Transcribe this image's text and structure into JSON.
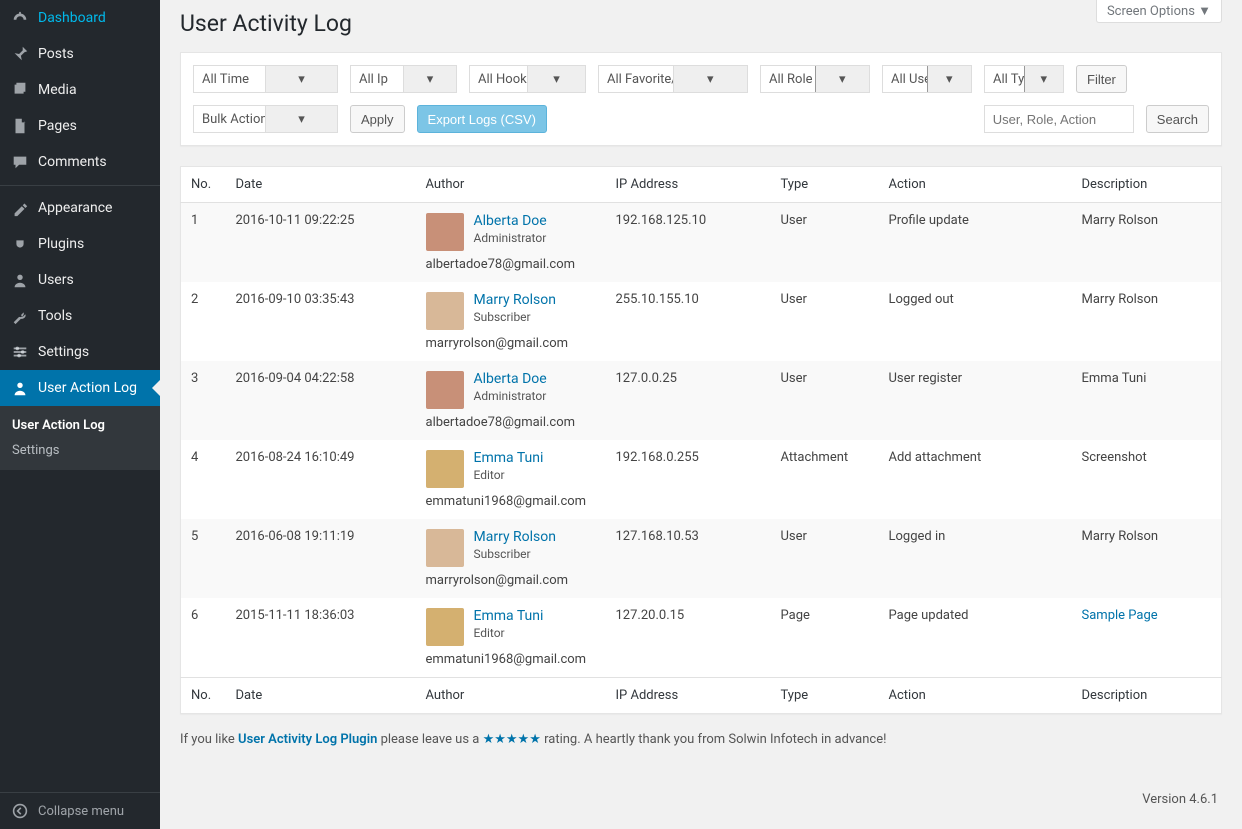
{
  "screen_options": "Screen Options ▼",
  "page_title": "User Activity Log",
  "sidebar": {
    "items": [
      {
        "icon": "dashboard",
        "label": "Dashboard"
      },
      {
        "icon": "pin",
        "label": "Posts"
      },
      {
        "icon": "media",
        "label": "Media"
      },
      {
        "icon": "page",
        "label": "Pages"
      },
      {
        "icon": "comment",
        "label": "Comments"
      },
      {
        "sep": true
      },
      {
        "icon": "appearance",
        "label": "Appearance"
      },
      {
        "icon": "plug",
        "label": "Plugins"
      },
      {
        "icon": "user",
        "label": "Users"
      },
      {
        "icon": "wrench",
        "label": "Tools"
      },
      {
        "icon": "settings",
        "label": "Settings"
      },
      {
        "icon": "user",
        "label": "User Action Log",
        "active": true
      }
    ],
    "submenu": [
      {
        "label": "User Action Log",
        "current": true
      },
      {
        "label": "Settings"
      }
    ],
    "collapse": "Collapse menu"
  },
  "filters": {
    "time": "All Time",
    "ip": "All Ip",
    "hook": "All Hook",
    "fav": "All Favorite/Unfavorite",
    "role": "All Role",
    "user": "All User",
    "type": "All Type",
    "filter_btn": "Filter",
    "bulk": "Bulk Actions",
    "apply": "Apply",
    "export": "Export Logs (CSV)",
    "search_ph": "User, Role, Action",
    "search_btn": "Search",
    "w_time": 145,
    "w_ip": 107,
    "w_hook": 117,
    "w_fav": 150,
    "w_role": 110,
    "w_user": 90,
    "w_type": 80,
    "w_bulk": 145
  },
  "columns": {
    "no": "No.",
    "date": "Date",
    "author": "Author",
    "ip": "IP Address",
    "type": "Type",
    "action": "Action",
    "desc": "Description"
  },
  "rows": [
    {
      "no": "1",
      "date": "2016-10-11 09:22:25",
      "author": "Alberta Doe",
      "role": "Administrator",
      "email": "albertadoe78@gmail.com",
      "avatar": "#c89078",
      "ip": "192.168.125.10",
      "type": "User",
      "action": "Profile update",
      "desc": "Marry Rolson",
      "link": false
    },
    {
      "no": "2",
      "date": "2016-09-10 03:35:43",
      "author": "Marry Rolson",
      "role": "Subscriber",
      "email": "marryrolson@gmail.com",
      "avatar": "#d8b898",
      "ip": "255.10.155.10",
      "type": "User",
      "action": "Logged out",
      "desc": "Marry Rolson",
      "link": false
    },
    {
      "no": "3",
      "date": "2016-09-04 04:22:58",
      "author": "Alberta Doe",
      "role": "Administrator",
      "email": "albertadoe78@gmail.com",
      "avatar": "#c89078",
      "ip": "127.0.0.25",
      "type": "User",
      "action": "User register",
      "desc": "Emma Tuni",
      "link": false
    },
    {
      "no": "4",
      "date": "2016-08-24 16:10:49",
      "author": "Emma Tuni",
      "role": "Editor",
      "email": "emmatuni1968@gmail.com",
      "avatar": "#d4b070",
      "ip": "192.168.0.255",
      "type": "Attachment",
      "action": "Add attachment",
      "desc": "Screenshot",
      "link": false
    },
    {
      "no": "5",
      "date": "2016-06-08 19:11:19",
      "author": "Marry Rolson",
      "role": "Subscriber",
      "email": "marryrolson@gmail.com",
      "avatar": "#d8b898",
      "ip": "127.168.10.53",
      "type": "User",
      "action": "Logged in",
      "desc": "Marry Rolson",
      "link": false
    },
    {
      "no": "6",
      "date": "2015-11-11 18:36:03",
      "author": "Emma Tuni",
      "role": "Editor",
      "email": "emmatuni1968@gmail.com",
      "avatar": "#d4b070",
      "ip": "127.20.0.15",
      "type": "Page",
      "action": "Page updated",
      "desc": "Sample Page",
      "link": true
    }
  ],
  "footer": {
    "pre": "If you like ",
    "plugin": "User Activity Log Plugin",
    "mid": " please leave us a ",
    "stars": "★★★★★",
    "post": " rating. A heartly thank you from Solwin Infotech in advance!",
    "version": "Version 4.6.1"
  }
}
